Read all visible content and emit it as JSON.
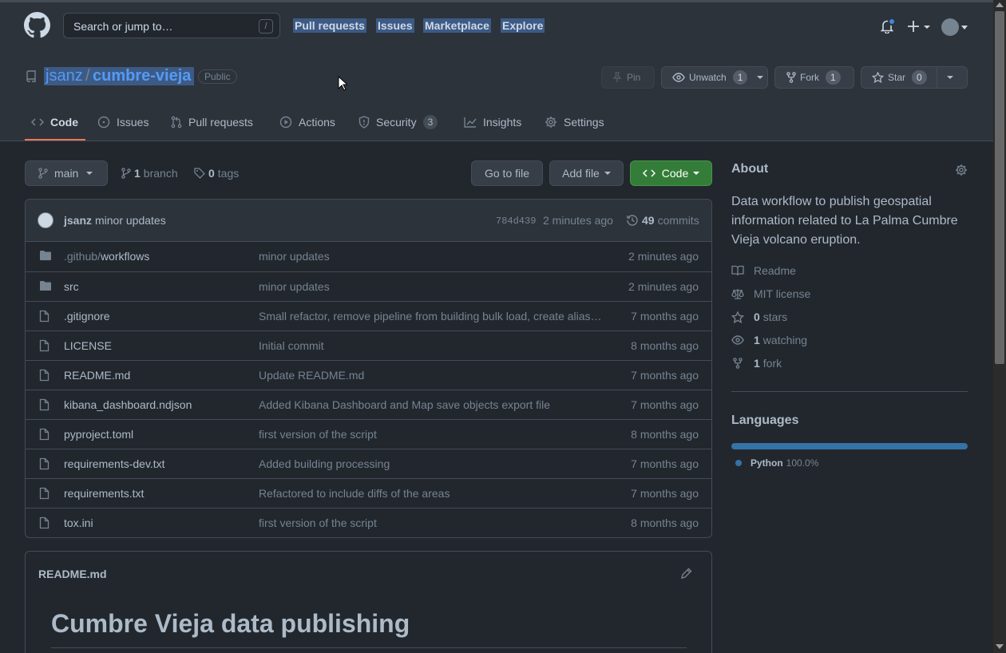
{
  "header": {
    "search_placeholder": "Search or jump to…",
    "search_shortcut": "/",
    "nav": [
      "Pull requests",
      "Issues",
      "Marketplace",
      "Explore"
    ]
  },
  "repo": {
    "owner": "jsanz",
    "separator": "/",
    "name": "cumbre-vieja",
    "visibility": "Public",
    "pin_label": "Pin",
    "watch_label": "Unwatch",
    "watch_count": "1",
    "fork_label": "Fork",
    "fork_count": "1",
    "star_label": "Star",
    "star_count": "0"
  },
  "tabs": [
    {
      "label": "Code",
      "icon": "code-icon"
    },
    {
      "label": "Issues",
      "icon": "issue-icon"
    },
    {
      "label": "Pull requests",
      "icon": "pull-request-icon"
    },
    {
      "label": "Actions",
      "icon": "play-icon"
    },
    {
      "label": "Security",
      "icon": "shield-icon",
      "count": "3"
    },
    {
      "label": "Insights",
      "icon": "graph-icon"
    },
    {
      "label": "Settings",
      "icon": "gear-icon"
    }
  ],
  "branch_bar": {
    "branch": "main",
    "branch_count": "1",
    "branch_word": "branch",
    "tag_count": "0",
    "tag_word": "tags",
    "go_to_file": "Go to file",
    "add_file": "Add file",
    "code": "Code"
  },
  "latest_commit": {
    "user": "jsanz",
    "message": "minor updates",
    "sha": "784d439",
    "time": "2 minutes ago",
    "commit_count": "49",
    "commit_word": "commits"
  },
  "files": [
    {
      "type": "dir",
      "prefix": ".github/",
      "name": "workflows",
      "message": "minor updates",
      "time": "2 minutes ago"
    },
    {
      "type": "dir",
      "prefix": "",
      "name": "src",
      "message": "minor updates",
      "time": "2 minutes ago"
    },
    {
      "type": "file",
      "prefix": "",
      "name": ".gitignore",
      "message": "Small refactor, remove pipeline from building bulk load, create alias…",
      "time": "7 months ago"
    },
    {
      "type": "file",
      "prefix": "",
      "name": "LICENSE",
      "message": "Initial commit",
      "time": "8 months ago"
    },
    {
      "type": "file",
      "prefix": "",
      "name": "README.md",
      "message": "Update README.md",
      "time": "7 months ago"
    },
    {
      "type": "file",
      "prefix": "",
      "name": "kibana_dashboard.ndjson",
      "message": "Added Kibana Dashboard and Map save objects export file",
      "time": "7 months ago"
    },
    {
      "type": "file",
      "prefix": "",
      "name": "pyproject.toml",
      "message": "first version of the script",
      "time": "8 months ago"
    },
    {
      "type": "file",
      "prefix": "",
      "name": "requirements-dev.txt",
      "message": "Added building processing",
      "time": "7 months ago"
    },
    {
      "type": "file",
      "prefix": "",
      "name": "requirements.txt",
      "message": "Refactored to include diffs of the areas",
      "time": "7 months ago"
    },
    {
      "type": "file",
      "prefix": "",
      "name": "tox.ini",
      "message": "first version of the script",
      "time": "8 months ago"
    }
  ],
  "readme": {
    "filename": "README.md",
    "heading": "Cumbre Vieja data publishing"
  },
  "about": {
    "title": "About",
    "description": "Data workflow to publish geospatial information related to La Palma Cumbre Vieja volcano eruption.",
    "readme": "Readme",
    "license": "MIT license",
    "stars_count": "0",
    "stars_word": "stars",
    "watching_count": "1",
    "watching_word": "watching",
    "fork_count": "1",
    "fork_word": "fork"
  },
  "languages": {
    "title": "Languages",
    "items": [
      {
        "name": "Python",
        "percent": "100.0%",
        "share": 100,
        "color": "#3572a5"
      }
    ]
  },
  "colors": {
    "accent_link": "#539bf5",
    "tab_underline": "#ec775c",
    "code_button": "#347d39",
    "notification_dot": "#4184e4"
  }
}
